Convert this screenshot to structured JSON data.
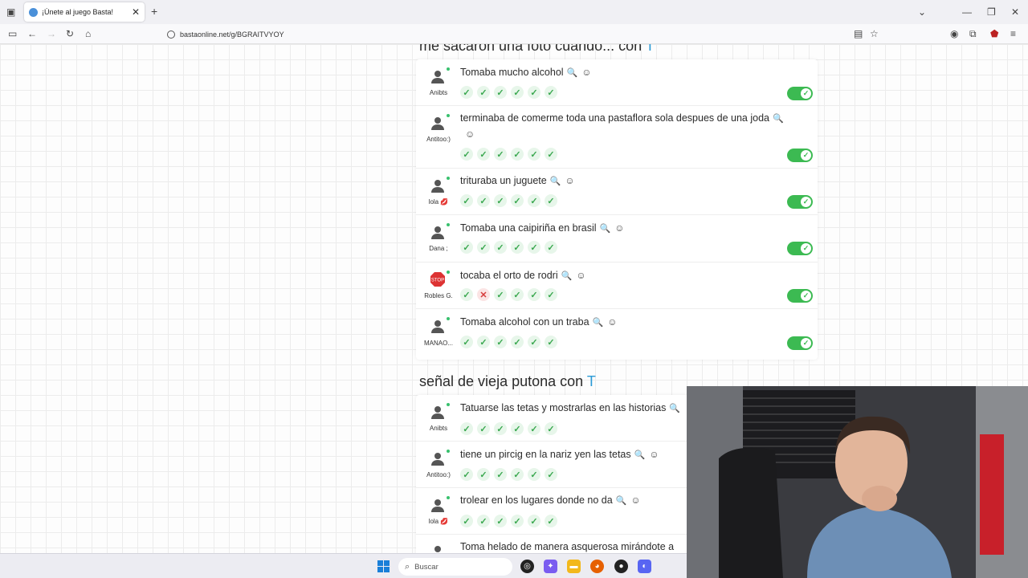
{
  "browser": {
    "tab_title": "¡Únete al juego Basta!",
    "url": "bastaonline.net/g/BGRAITVYOY",
    "tab_close": "✕",
    "new_tab": "+"
  },
  "sections": [
    {
      "title": "me sacaron una foto cuando... con",
      "letter": "T",
      "rows": [
        {
          "user": "Anibts",
          "answer": "Tomaba mucho alcohol",
          "votes": [
            "ok",
            "ok",
            "ok",
            "ok",
            "ok",
            "ok"
          ]
        },
        {
          "user": "Antitoo:)",
          "answer": "terminaba de comerme toda una pastaflora sola despues de una joda",
          "votes": [
            "ok",
            "ok",
            "ok",
            "ok",
            "ok",
            "ok"
          ]
        },
        {
          "user": "lola 💋",
          "answer": "trituraba un juguete",
          "votes": [
            "ok",
            "ok",
            "ok",
            "ok",
            "ok",
            "ok"
          ]
        },
        {
          "user": "Dana ;",
          "answer": "Tomaba una caipiriña en brasil",
          "votes": [
            "ok",
            "ok",
            "ok",
            "ok",
            "ok",
            "ok"
          ]
        },
        {
          "user": "Robles G.",
          "answer": "tocaba el orto de rodri",
          "votes": [
            "ok",
            "no",
            "ok",
            "ok",
            "ok",
            "ok"
          ]
        },
        {
          "user": "MANAO...",
          "answer": "Tomaba alcohol con un traba",
          "votes": [
            "ok",
            "ok",
            "ok",
            "ok",
            "ok",
            "ok"
          ]
        }
      ]
    },
    {
      "title": "señal de vieja putona con",
      "letter": "T",
      "rows": [
        {
          "user": "Anibts",
          "answer": "Tatuarse las tetas y mostrarlas en las historias"
        },
        {
          "user": "Antitoo:)",
          "answer": "tiene un pircig en la nariz yen las tetas"
        },
        {
          "user": "lola 💋",
          "answer": "trolear en los lugares donde no da"
        },
        {
          "user": "",
          "answer": "Toma helado de manera asquerosa mirándote a"
        }
      ]
    }
  ],
  "taskbar": {
    "search_placeholder": "Buscar"
  },
  "icons": {
    "search": "🔍",
    "emoji": "☺",
    "check": "✓",
    "cross": "✕"
  },
  "colors": {
    "accent": "#2b9ad6",
    "toggle_on": "#3cba52",
    "vote_ok": "#3aa84f",
    "vote_no": "#d63b3b"
  }
}
